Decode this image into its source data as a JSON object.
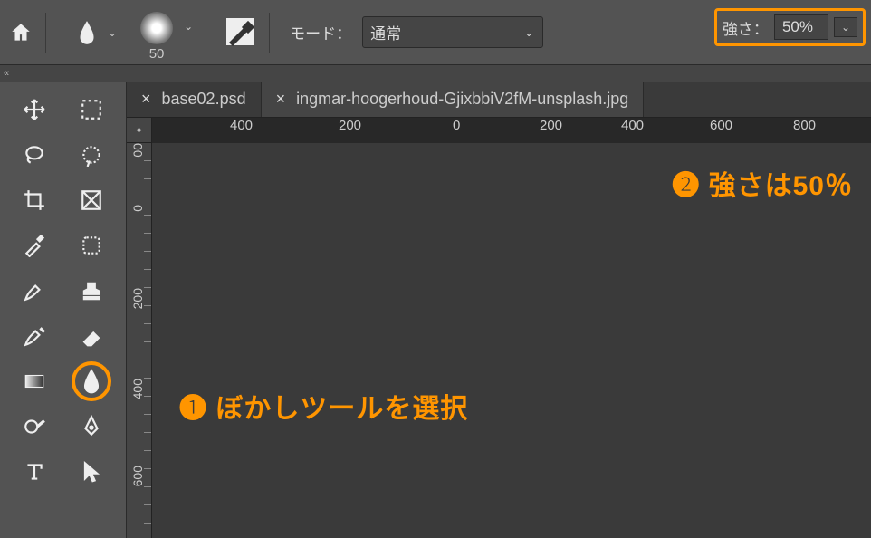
{
  "topbar": {
    "brush_size": "50",
    "mode_label": "モード：",
    "mode_value": "通常",
    "strength_label": "強さ：",
    "strength_value": "50%"
  },
  "tabs": [
    {
      "name": "base02.psd",
      "active": false
    },
    {
      "name": "ingmar-hoogerhoud-GjixbbiV2fM-unsplash.jpg",
      "active": true
    }
  ],
  "ruler_h_ticks": [
    {
      "label": "400",
      "pos": 48
    },
    {
      "label": "200",
      "pos": 248
    },
    {
      "label": "0",
      "pos": 448
    },
    {
      "label": "200",
      "pos": 548
    },
    {
      "label": "400",
      "pos": 648
    },
    {
      "label": "600",
      "pos": 748
    },
    {
      "label": "800",
      "pos": 848
    }
  ],
  "ruler_v_ticks": [
    {
      "label": "00",
      "pos": -5
    },
    {
      "label": "0",
      "pos": 70
    },
    {
      "label": "200",
      "pos": 170
    },
    {
      "label": "400",
      "pos": 270
    },
    {
      "label": "600",
      "pos": 370
    }
  ],
  "annotations": {
    "a2": "❷ 強さは50％",
    "a1": "❶ ぼかしツールを選択"
  },
  "tools": [
    [
      "move-icon",
      "marquee-icon"
    ],
    [
      "lasso-icon",
      "magic-wand-icon"
    ],
    [
      "crop-icon",
      "frame-icon"
    ],
    [
      "eyedropper-icon",
      "patch-icon"
    ],
    [
      "brush-icon",
      "stamp-icon"
    ],
    [
      "history-brush-icon",
      "eraser-icon"
    ],
    [
      "gradient-icon",
      "blur-tool-icon"
    ],
    [
      "dodge-icon",
      "pen-icon"
    ],
    [
      "type-icon",
      "path-selection-icon"
    ]
  ]
}
